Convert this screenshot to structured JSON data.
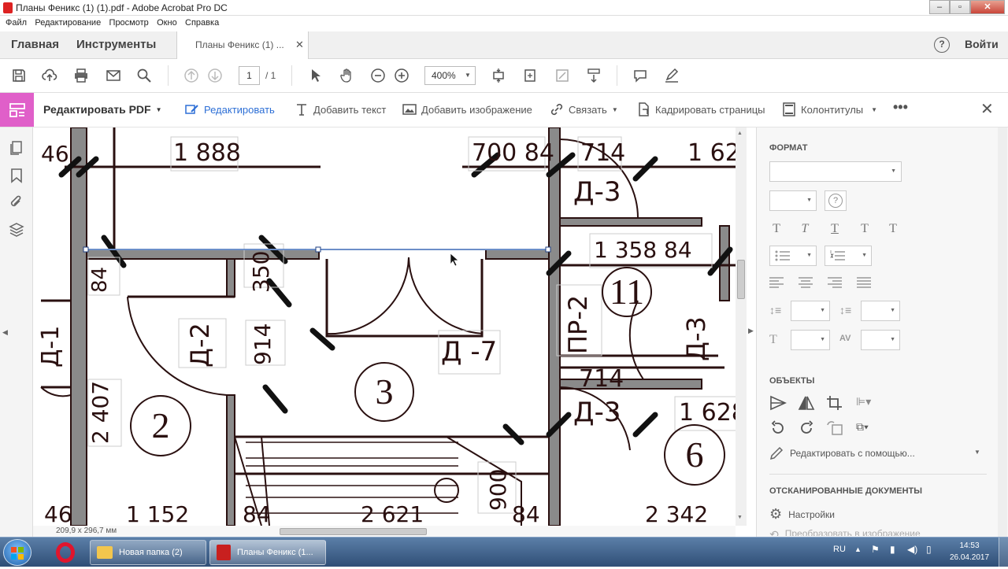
{
  "window": {
    "title": "Планы Феникс (1) (1).pdf - Adobe Acrobat Pro DC"
  },
  "menu": [
    "Файл",
    "Редактирование",
    "Просмотр",
    "Окно",
    "Справка"
  ],
  "tabs": {
    "home": "Главная",
    "tools": "Инструменты",
    "doc": "Планы Феникс (1) ...",
    "signin": "Войти"
  },
  "toolbar": {
    "page_current": "1",
    "page_total": "/ 1",
    "zoom": "400%"
  },
  "editbar": {
    "title": "Редактировать PDF",
    "edit": "Редактировать",
    "add_text": "Добавить текст",
    "add_image": "Добавить изображение",
    "link": "Связать",
    "crop": "Кадрировать страницы",
    "header_footer": "Колонтитулы"
  },
  "right_panel": {
    "format_heading": "ФОРМАТ",
    "objects_heading": "ОБЪЕКТЫ",
    "edit_with": "Редактировать с помощью...",
    "scanned_heading": "ОТСКАНИРОВАННЫЕ ДОКУМЕНТЫ",
    "settings": "Настройки",
    "convert_image": "Преобразовать в изображение",
    "format_icons": [
      "T",
      "T",
      "T",
      "T",
      "T"
    ]
  },
  "status": {
    "page_size": "209,9 x 296,7 мм"
  },
  "taskbar": {
    "folder": "Новая папка (2)",
    "acrobat": "Планы Феникс (1...",
    "lang": "RU",
    "time": "14:53",
    "date": "26.04.2017"
  },
  "drawing": {
    "labels": {
      "dim_1888": "1 888",
      "dim_700_84": "700 84",
      "dim_714_top": "714",
      "dim_162": "1 62",
      "dim_46_top": "46",
      "d3_top": "Д-3",
      "dim_1358_84": "1 358    84",
      "room_11": "11",
      "dim_84_left": "84",
      "dim_350": "350",
      "pr2": "ПР-2",
      "d_left": "Д-1",
      "d2": "Д-2",
      "dim_914": "914",
      "room_3": "3",
      "d7": "Д -7",
      "d3_right": "Д-3",
      "dim_714_mid": "714",
      "d3_mid": "Д-3",
      "dim_2407": "2 407",
      "room_2": "2",
      "dim_1628": "1 628",
      "room_6": "6",
      "dim_900": "900",
      "dim_46_bottom": "46",
      "dim_1152": "1 152",
      "dim_84_bottom": "84",
      "dim_2621": "2 621",
      "dim_84_bottom2": "84",
      "dim_2342": "2 342"
    }
  }
}
